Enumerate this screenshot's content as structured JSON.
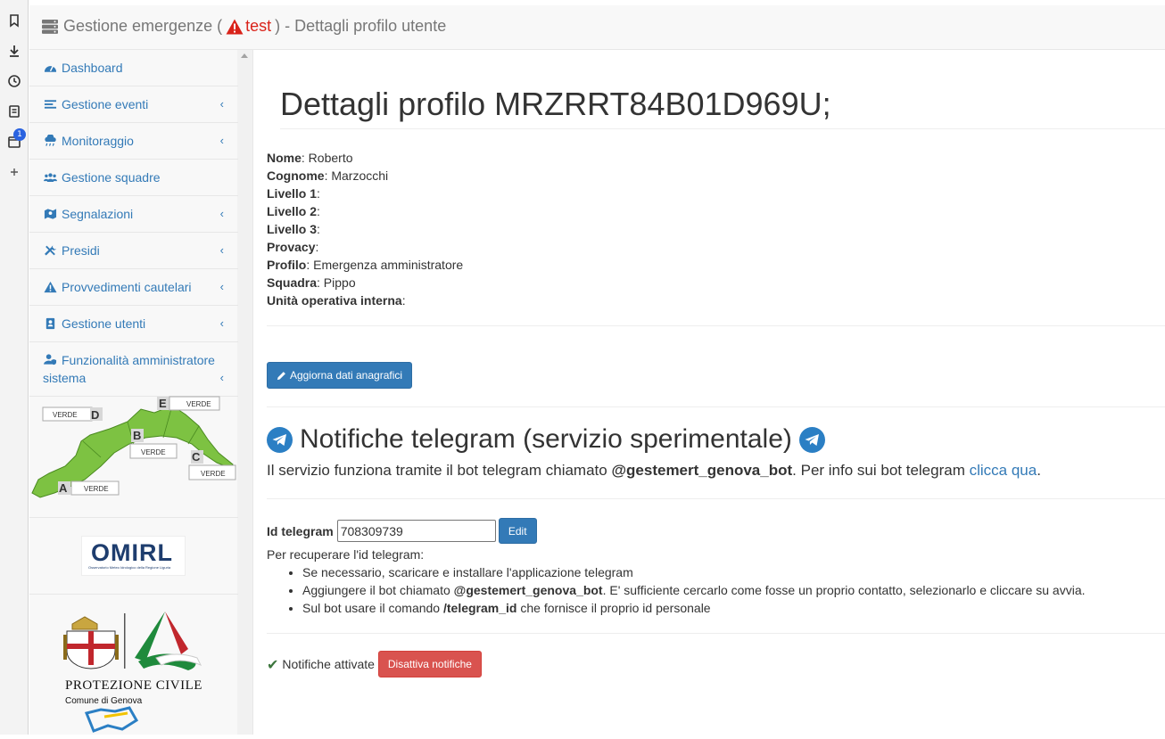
{
  "browser_strip": {
    "icons": [
      "bookmark-icon",
      "download-icon",
      "history-icon",
      "reading-list-icon",
      "calendar-icon",
      "add-icon"
    ],
    "badge": "1"
  },
  "header": {
    "title_prefix": "Gestione emergenze (",
    "env_label": "test",
    "title_suffix": ") - Dettagli profilo utente"
  },
  "sidebar": {
    "items": [
      {
        "label": "Dashboard",
        "icon": "dashboard-icon",
        "chevron": false
      },
      {
        "label": "Gestione eventi",
        "icon": "list-icon",
        "chevron": true
      },
      {
        "label": "Monitoraggio",
        "icon": "cloud-rain-icon",
        "chevron": true
      },
      {
        "label": "Gestione squadre",
        "icon": "users-icon",
        "chevron": false
      },
      {
        "label": "Segnalazioni",
        "icon": "map-marker-icon",
        "chevron": true
      },
      {
        "label": "Presidi",
        "icon": "tools-icon",
        "chevron": true
      },
      {
        "label": "Provvedimenti cautelari",
        "icon": "warning-icon",
        "chevron": true
      },
      {
        "label": "Gestione utenti",
        "icon": "address-book-icon",
        "chevron": true
      },
      {
        "label": "Funzionalità amministratore sistema",
        "icon": "user-shield-icon",
        "chevron": true
      }
    ],
    "chevron_glyph": "‹",
    "map": {
      "zones": [
        {
          "letter": "D",
          "status": "VERDE"
        },
        {
          "letter": "E",
          "status": "VERDE"
        },
        {
          "letter": "B",
          "status": "VERDE"
        },
        {
          "letter": "C",
          "status": "VERDE"
        },
        {
          "letter": "A",
          "status": "VERDE"
        }
      ]
    },
    "omirl": {
      "title": "OMIRL",
      "subtitle": "Osservatorio Meteo Idrologico della Regione Liguria"
    },
    "protezione_civile": {
      "title": "PROTEZIONE CIVILE",
      "subtitle": "Comune di Genova"
    }
  },
  "main": {
    "page_title": "Dettagli profilo MRZRRT84B01D969U;",
    "fields": [
      {
        "label": "Nome",
        "value": " Roberto"
      },
      {
        "label": "Cognome",
        "value": " Marzocchi"
      },
      {
        "label": "Livello 1",
        "value": ""
      },
      {
        "label": "Livello 2",
        "value": ""
      },
      {
        "label": "Livello 3",
        "value": ""
      },
      {
        "label": "Provacy",
        "value": ""
      },
      {
        "label": "Profilo",
        "value": " Emergenza amministratore"
      },
      {
        "label": "Squadra",
        "value": " Pippo"
      },
      {
        "label": "Unità operativa interna",
        "value": ""
      }
    ],
    "update_button": "Aggiorna dati anagrafici",
    "telegram": {
      "title": "Notifiche telegram (servizio sperimentale)",
      "desc_prefix": "Il servizio funziona tramite il bot telegram chiamato ",
      "bot_name": "@gestemert_genova_bot",
      "desc_middle": ". Per info sui bot telegram ",
      "link_text": "clicca qua",
      "desc_suffix": ".",
      "id_label": "Id telegram",
      "id_value": "708309739",
      "edit_button": "Edit",
      "instructions_intro": "Per recuperare l'id telegram:",
      "step1": "Se necessario, scaricare e installare l'applicazione telegram",
      "step2_prefix": "Aggiungere il bot chiamato ",
      "step2_bot": "@gestemert_genova_bot",
      "step2_suffix": ". E' sufficiente cercarlo come fosse un proprio contatto, selezionarlo e cliccare su avvia.",
      "step3_prefix": "Sul bot usare il comando ",
      "step3_cmd": "/telegram_id",
      "step3_suffix": " che fornisce il proprio id personale",
      "notif_status": "Notifiche attivate",
      "disable_button": "Disattiva notifiche"
    }
  },
  "colors": {
    "link": "#337ab7",
    "danger": "#d9534f",
    "warning_red": "#d9231a",
    "telegram_blue": "#2b7fc4",
    "success": "#3c763d"
  }
}
